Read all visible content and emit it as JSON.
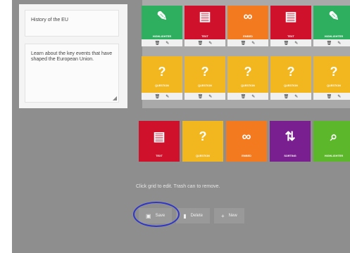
{
  "panel": {
    "title": "History of the EU",
    "description": "Learn about the key events that have shaped the European Union."
  },
  "grid": {
    "row1": [
      {
        "label": "HIGHLIGHTER",
        "icon": "highlighter-icon",
        "glyph": "✎",
        "color": "#2eae5f"
      },
      {
        "label": "TEXT",
        "icon": "document-icon",
        "glyph": "▤",
        "color": "#d0112b"
      },
      {
        "label": "EMBED",
        "icon": "link-icon",
        "glyph": "∞",
        "color": "#f47a20"
      },
      {
        "label": "TEXT",
        "icon": "document-icon",
        "glyph": "▤",
        "color": "#d0112b"
      },
      {
        "label": "HIGHLIGHTER",
        "icon": "highlighter-icon",
        "glyph": "✎",
        "color": "#2eae5f"
      }
    ],
    "row2": [
      {
        "label": "QUESTION",
        "icon": "question-icon",
        "glyph": "?",
        "color": "#f2b71f"
      },
      {
        "label": "QUESTION",
        "icon": "question-icon",
        "glyph": "?",
        "color": "#f2b71f"
      },
      {
        "label": "QUESTION",
        "icon": "question-icon",
        "glyph": "?",
        "color": "#f2b71f"
      },
      {
        "label": "QUESTION",
        "icon": "question-icon",
        "glyph": "?",
        "color": "#f2b71f"
      },
      {
        "label": "QUESTION",
        "icon": "question-icon",
        "glyph": "?",
        "color": "#f2b71f"
      }
    ],
    "actions": {
      "delete": "🗑",
      "edit": "✎"
    }
  },
  "palette": [
    {
      "label": "TEXT",
      "icon": "document-icon",
      "glyph": "▤",
      "color": "#d0112b"
    },
    {
      "label": "QUESTION",
      "icon": "question-icon",
      "glyph": "?",
      "color": "#f2b71f"
    },
    {
      "label": "EMBED",
      "icon": "link-icon",
      "glyph": "∞",
      "color": "#f47a20"
    },
    {
      "label": "SORTING",
      "icon": "sorting-icon",
      "glyph": "⇅",
      "color": "#7a1f8f"
    },
    {
      "label": "HIGHLIGHTER",
      "icon": "search-icon",
      "glyph": "⌕",
      "color": "#5cb82a"
    }
  ],
  "hint": "Click grid to edit. Trash can to remove.",
  "buttons": {
    "save": {
      "label": "Save",
      "icon": "save-icon",
      "glyph": "▣"
    },
    "delete": {
      "label": "Delete",
      "icon": "trash-icon",
      "glyph": "▮"
    },
    "new": {
      "label": "New",
      "icon": "plus-icon",
      "glyph": "+"
    }
  }
}
